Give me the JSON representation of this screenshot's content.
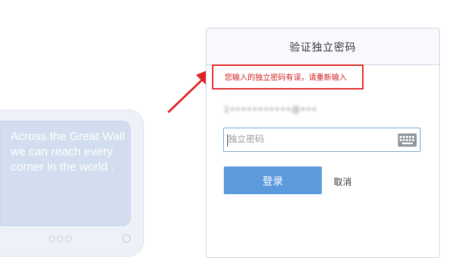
{
  "illustration": {
    "tagline": "Across the Great Wall we can reach every corner in the world ."
  },
  "panel": {
    "title": "验证独立密码",
    "error_message": "您输入的独立密码有误，请重新输入",
    "account_masked": "1•••••••••••@•••",
    "password": {
      "placeholder": "独立密码",
      "value": ""
    },
    "login_label": "登录",
    "cancel_label": "取消"
  },
  "icons": {
    "keyboard": "keyboard-icon",
    "annotation_arrow": "arrow-icon"
  },
  "colors": {
    "error": "#d42020",
    "annotation": "#e02222",
    "primary_button": "#5b9bdc",
    "input_border": "#6fa2cf"
  }
}
